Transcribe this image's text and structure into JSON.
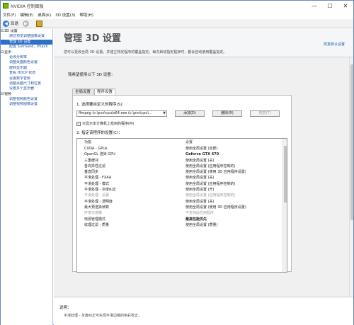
{
  "window": {
    "title": "NVIDIA 控制面板",
    "minimize": "—",
    "maximize": "☐",
    "close": "✕"
  },
  "menu": [
    "文件(F)",
    "编辑(E)",
    "桌面(K)",
    "3D 设置(3)",
    "帮助(H)"
  ],
  "toolbar": {
    "back_label": "后退",
    "back_icon": "left-arrow-icon",
    "forward_icon": "right-arrow-icon",
    "home_icon": "home-icon"
  },
  "tree": [
    {
      "level": 0,
      "label": "3D 设置",
      "expander": "⊟",
      "kind": "cat"
    },
    {
      "level": 1,
      "label": "通过预览调整图像设置",
      "kind": "item"
    },
    {
      "level": 1,
      "label": "管理 3D 设置",
      "kind": "item",
      "selected": true
    },
    {
      "level": 1,
      "label": "配置 Surround、PhysX",
      "kind": "item"
    },
    {
      "level": 0,
      "label": "显示",
      "expander": "⊟",
      "kind": "cat"
    },
    {
      "level": 1,
      "label": "更改分辨率",
      "kind": "item"
    },
    {
      "level": 1,
      "label": "调整桌面颜色设置",
      "kind": "item"
    },
    {
      "level": 1,
      "label": "旋转显示器",
      "kind": "item"
    },
    {
      "level": 1,
      "label": "查看 HDCP 状态",
      "kind": "item"
    },
    {
      "level": 1,
      "label": "设置数字音频",
      "kind": "item"
    },
    {
      "level": 1,
      "label": "调整桌面尺寸和位置",
      "kind": "item"
    },
    {
      "level": 1,
      "label": "设置多个显示器",
      "kind": "item"
    },
    {
      "level": 0,
      "label": "视频",
      "expander": "⊟",
      "kind": "cat"
    },
    {
      "level": 1,
      "label": "调整视频颜色设置",
      "kind": "item"
    },
    {
      "level": 1,
      "label": "调整视频图像设置",
      "kind": "item"
    }
  ],
  "header": {
    "title": "管理 3D 设置",
    "restore_link": "恢复默认设置",
    "description": "您可以更改全局 3D 设置，并建立特定程序的覆盖指定。每次启动指定程序时，都会自动使用覆盖指定。"
  },
  "i_want_label": "我希望使用以下 3D 设置：",
  "tabs": [
    {
      "label": "全局设置",
      "active": false
    },
    {
      "label": "程序设置",
      "active": true
    }
  ],
  "program": {
    "step1_label": "1. 选择要自定义的程序(S)：",
    "selected": "ffmpeg (c:\\pvs\\cpu\\x64.exe (c:\\pvs\\cpu\\...",
    "add_button": "添加(D)",
    "remove_button": "删除(R)",
    "restore_button": "恢复(T)",
    "checkbox_label": "只显示本计算机上找到的程序(M)",
    "checkbox_checked": true,
    "step2_label": "2. 指定该程序的设置(C)：",
    "col_feature": "功能",
    "col_setting": "设置"
  },
  "features": [
    {
      "name": "CUDA - GPUs",
      "value": "使用全局设置 (全部)"
    },
    {
      "name": "OpenGL 渲染 GPU",
      "value": "Geforce GTX 670",
      "bold": true
    },
    {
      "name": "三重缓冲",
      "value": "使用全局设置 (关)"
    },
    {
      "name": "各向异性过滤",
      "value": "使用全局设置 (应用程序控制的)"
    },
    {
      "name": "垂直同步",
      "value": "使用全局设置 (使用 3D 应用程序设置)"
    },
    {
      "name": "平滑处理 - FXAA",
      "value": "使用全局设置 (关)"
    },
    {
      "name": "平滑处理 - 模式",
      "value": "使用全局设置 (应用程序控制的)"
    },
    {
      "name": "平滑处理 - 灰度纠正",
      "value": "使用全局设置 (开)"
    },
    {
      "name": "平滑处理 - 设置",
      "value": "使用全局设置 (应用程序控制的)",
      "dim": true
    },
    {
      "name": "平滑处理 - 透明度",
      "value": "使用全局设置 (关)"
    },
    {
      "name": "最大预渲染帧数",
      "value": "使用全局设置 (使用 3D 应用程序设置)"
    },
    {
      "name": "环境光遮蔽",
      "value": "不支持此应用程序",
      "dim": true
    },
    {
      "name": "电源管理模式",
      "value": "最高性能优先",
      "bold": true
    },
    {
      "name": "纹理过滤 - 质量",
      "value": "使用全局设置 (质量)"
    }
  ],
  "description": {
    "title": "说明：",
    "text": "平滑处理 - 灰度纠正可实现平滑边缘的色彩校正。"
  }
}
